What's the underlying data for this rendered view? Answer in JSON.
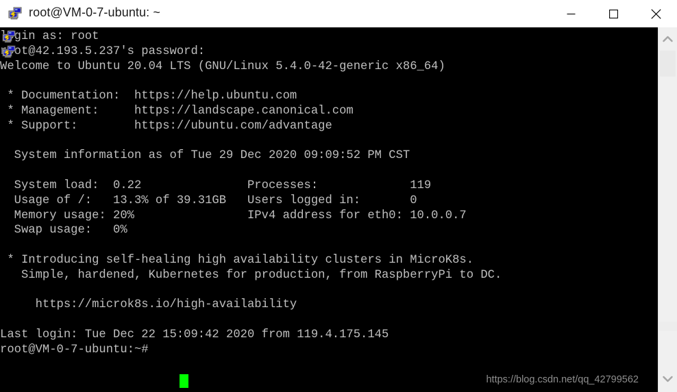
{
  "window": {
    "title": "root@VM-0-7-ubuntu: ~",
    "icon": "putty-computer-icon",
    "controls": {
      "minimize_label": "Minimize",
      "maximize_label": "Maximize",
      "close_label": "Close"
    }
  },
  "terminal": {
    "foreground_color": "#bfbfbf",
    "background_color": "#000000",
    "cursor_color": "#00ff00",
    "lines": [
      "login as: root",
      "root@42.193.5.237's password:",
      "Welcome to Ubuntu 20.04 LTS (GNU/Linux 5.4.0-42-generic x86_64)",
      "",
      " * Documentation:  https://help.ubuntu.com",
      " * Management:     https://landscape.canonical.com",
      " * Support:        https://ubuntu.com/advantage",
      "",
      "  System information as of Tue 29 Dec 2020 09:09:52 PM CST",
      "",
      "  System load:  0.22               Processes:             119",
      "  Usage of /:   13.3% of 39.31GB   Users logged in:       0",
      "  Memory usage: 20%                IPv4 address for eth0: 10.0.0.7",
      "  Swap usage:   0%",
      "",
      " * Introducing self-healing high availability clusters in MicroK8s.",
      "   Simple, hardened, Kubernetes for production, from RaspberryPi to DC.",
      "",
      "     https://microk8s.io/high-availability",
      "",
      "Last login: Tue Dec 22 15:09:42 2020 from 119.4.175.145",
      "root@VM-0-7-ubuntu:~# "
    ],
    "prompt": "root@VM-0-7-ubuntu:~#",
    "overlay_icons": [
      "putty-computer-icon",
      "putty-computer-icon"
    ]
  },
  "system_information": {
    "header": "System information as of Tue 29 Dec 2020 09:09:52 PM CST",
    "timestamp": "Tue 29 Dec 2020 09:09:52 PM CST",
    "metrics": [
      {
        "label": "System load:",
        "value": "0.22"
      },
      {
        "label": "Usage of /:",
        "value": "13.3% of 39.31GB"
      },
      {
        "label": "Memory usage:",
        "value": "20%"
      },
      {
        "label": "Swap usage:",
        "value": "0%"
      },
      {
        "label": "Processes:",
        "value": "119"
      },
      {
        "label": "Users logged in:",
        "value": "0"
      },
      {
        "label": "IPv4 address for eth0:",
        "value": "10.0.0.7"
      }
    ]
  },
  "links": {
    "documentation": "https://help.ubuntu.com",
    "management": "https://landscape.canonical.com",
    "support": "https://ubuntu.com/advantage",
    "microk8s": "https://microk8s.io/high-availability"
  },
  "login": {
    "login_as": "login as: root",
    "password_prompt": "root@42.193.5.237's password:",
    "last_login": "Last login: Tue Dec 22 15:09:42 2020 from 119.4.175.145"
  },
  "watermark": {
    "text": "https://blog.csdn.net/qq_42799562"
  },
  "scrollbar": {
    "up_arrow": "chevron-up-icon",
    "down_arrow": "chevron-down-icon"
  }
}
